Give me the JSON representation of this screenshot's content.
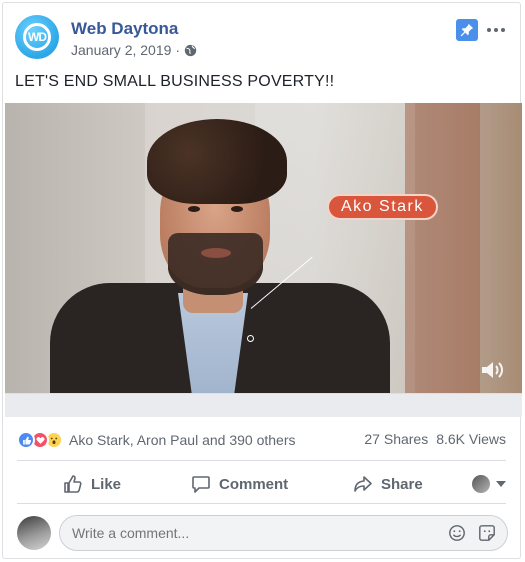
{
  "post": {
    "page_name": "Web Daytona",
    "date": "January 2, 2019",
    "separator": "·",
    "logo_text": "WD",
    "text": "LET'S END SMALL BUSINESS POVERTY!!"
  },
  "video": {
    "name_tag": "Ako Stark"
  },
  "engagement": {
    "reactions_text": "Ako Stark, Aron Paul and 390 others",
    "shares": "27 Shares",
    "views": "8.6K Views"
  },
  "actions": {
    "like": "Like",
    "comment": "Comment",
    "share": "Share"
  },
  "comment": {
    "placeholder": "Write a comment..."
  },
  "icons": {
    "globe": "globe-icon",
    "pin": "pin-icon",
    "more": "more-icon",
    "sound": "sound-icon",
    "like": "thumbs-up-icon",
    "comment": "speech-bubble-icon",
    "share": "share-arrow-icon",
    "emoji": "smiley-icon",
    "sticker": "sticker-icon"
  },
  "colors": {
    "brand_link": "#385898",
    "pin_bg": "#4a8fea",
    "name_tag_bg": "#d9553c",
    "text_secondary": "#606770"
  }
}
